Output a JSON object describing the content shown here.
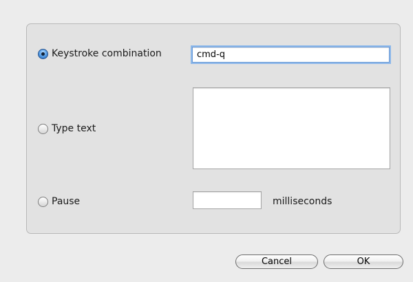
{
  "options": {
    "keystroke": {
      "label": "Keystroke combination",
      "selected": true,
      "value": "cmd-q"
    },
    "type_text": {
      "label": "Type text",
      "selected": false,
      "value": ""
    },
    "pause": {
      "label": "Pause",
      "selected": false,
      "value": "",
      "unit": "milliseconds"
    }
  },
  "buttons": {
    "cancel": "Cancel",
    "ok": "OK"
  },
  "colors": {
    "radio_selected": "#3f86d8",
    "focus_ring": "#8db8ea"
  }
}
